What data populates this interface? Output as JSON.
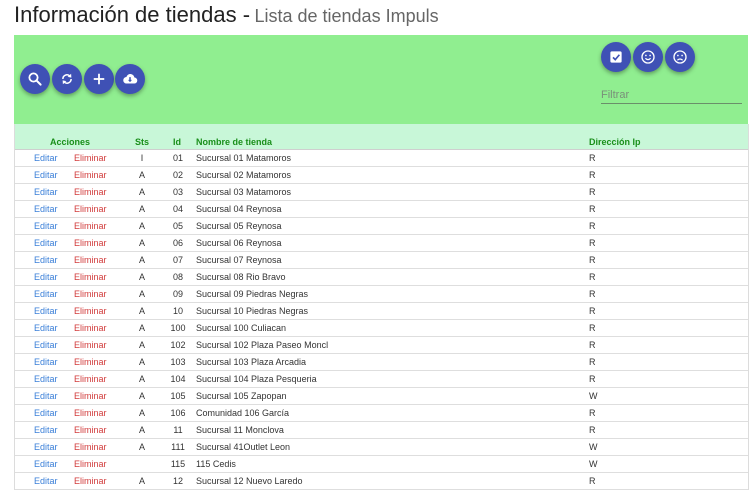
{
  "header": {
    "title": "Información de tiendas -",
    "subtitle": "Lista de tiendas Impuls"
  },
  "toolbar": {
    "buttons": [
      {
        "name": "search-button",
        "icon": "search-icon"
      },
      {
        "name": "refresh-button",
        "icon": "refresh-icon"
      },
      {
        "name": "add-button",
        "icon": "plus-icon"
      },
      {
        "name": "download-button",
        "icon": "cloud-download-icon"
      }
    ],
    "right_buttons": [
      {
        "name": "select-all-button",
        "icon": "checkbox-icon"
      },
      {
        "name": "satisfied-button",
        "icon": "smile-face-icon"
      },
      {
        "name": "dissatisfied-button",
        "icon": "sad-face-icon"
      }
    ],
    "filter_placeholder": "Filtrar",
    "colors": {
      "toolbar_bg": "#90ee90",
      "fab": "#3f51b5"
    }
  },
  "table": {
    "columns": {
      "acciones": "Acciones",
      "sts": "Sts",
      "id": "Id",
      "nombre": "Nombre de tienda",
      "ip": "Dirección Ip"
    },
    "edit_label": "Editar",
    "delete_label": "Eliminar",
    "rows": [
      {
        "sts": "I",
        "id": "01",
        "nombre": "Sucursal 01 Matamoros",
        "ip": "R"
      },
      {
        "sts": "A",
        "id": "02",
        "nombre": "Sucursal 02 Matamoros",
        "ip": "R"
      },
      {
        "sts": "A",
        "id": "03",
        "nombre": "Sucursal 03 Matamoros",
        "ip": "R"
      },
      {
        "sts": "A",
        "id": "04",
        "nombre": "Sucursal 04 Reynosa",
        "ip": "R"
      },
      {
        "sts": "A",
        "id": "05",
        "nombre": "Sucursal 05 Reynosa",
        "ip": "R"
      },
      {
        "sts": "A",
        "id": "06",
        "nombre": "Sucursal 06 Reynosa",
        "ip": "R"
      },
      {
        "sts": "A",
        "id": "07",
        "nombre": "Sucursal 07 Reynosa",
        "ip": "R"
      },
      {
        "sts": "A",
        "id": "08",
        "nombre": "Sucursal 08 Rio Bravo",
        "ip": "R"
      },
      {
        "sts": "A",
        "id": "09",
        "nombre": "Sucursal 09 Piedras Negras",
        "ip": "R"
      },
      {
        "sts": "A",
        "id": "10",
        "nombre": "Sucursal 10 Piedras Negras",
        "ip": "R"
      },
      {
        "sts": "A",
        "id": "100",
        "nombre": "Sucursal 100 Culiacan",
        "ip": "R"
      },
      {
        "sts": "A",
        "id": "102",
        "nombre": "Sucursal 102 Plaza Paseo Moncl",
        "ip": "R"
      },
      {
        "sts": "A",
        "id": "103",
        "nombre": "Sucursal 103 Plaza Arcadia",
        "ip": "R"
      },
      {
        "sts": "A",
        "id": "104",
        "nombre": "Sucursal 104 Plaza Pesqueria",
        "ip": "R"
      },
      {
        "sts": "A",
        "id": "105",
        "nombre": "Sucursal 105 Zapopan",
        "ip": "W"
      },
      {
        "sts": "A",
        "id": "106",
        "nombre": "Comunidad 106 García",
        "ip": "R"
      },
      {
        "sts": "A",
        "id": "11",
        "nombre": "Sucursal 11 Monclova",
        "ip": "R"
      },
      {
        "sts": "A",
        "id": "111",
        "nombre": "Sucursal 41Outlet Leon",
        "ip": "W"
      },
      {
        "sts": "",
        "id": "115",
        "nombre": "115 Cedis",
        "ip": "W"
      },
      {
        "sts": "A",
        "id": "12",
        "nombre": "Sucursal 12 Nuevo Laredo",
        "ip": "R"
      }
    ]
  }
}
